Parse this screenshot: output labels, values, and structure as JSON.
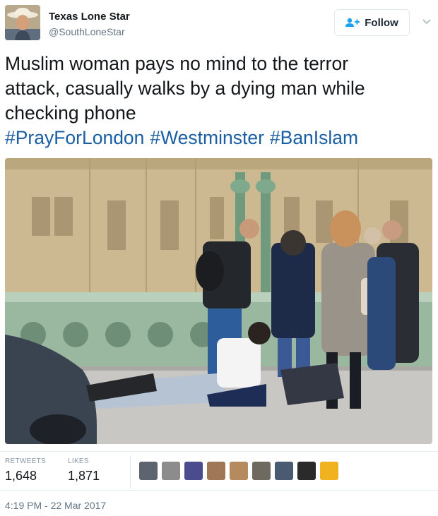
{
  "author": {
    "display_name": "Texas Lone Star",
    "handle": "@SouthLoneStar"
  },
  "follow_button": {
    "label": "Follow"
  },
  "tweet": {
    "lines": [
      "Muslim woman pays no mind to the terror",
      "attack, casually walks by a dying man while",
      "checking phone"
    ],
    "hashtags": [
      "#PrayForLondon",
      "#Westminster",
      "#BanIslam"
    ]
  },
  "stats": {
    "retweets_label": "RETWEETS",
    "retweets_value": "1,648",
    "likes_label": "LIKES",
    "likes_value": "1,871"
  },
  "timestamp": "4:19 PM - 22 Mar 2017",
  "colors": {
    "hashtag": "#1b5fa3",
    "muted": "#657786",
    "text": "#14171a"
  },
  "icons": {
    "follow": "add-user-icon",
    "menu": "chevron-down-icon"
  }
}
